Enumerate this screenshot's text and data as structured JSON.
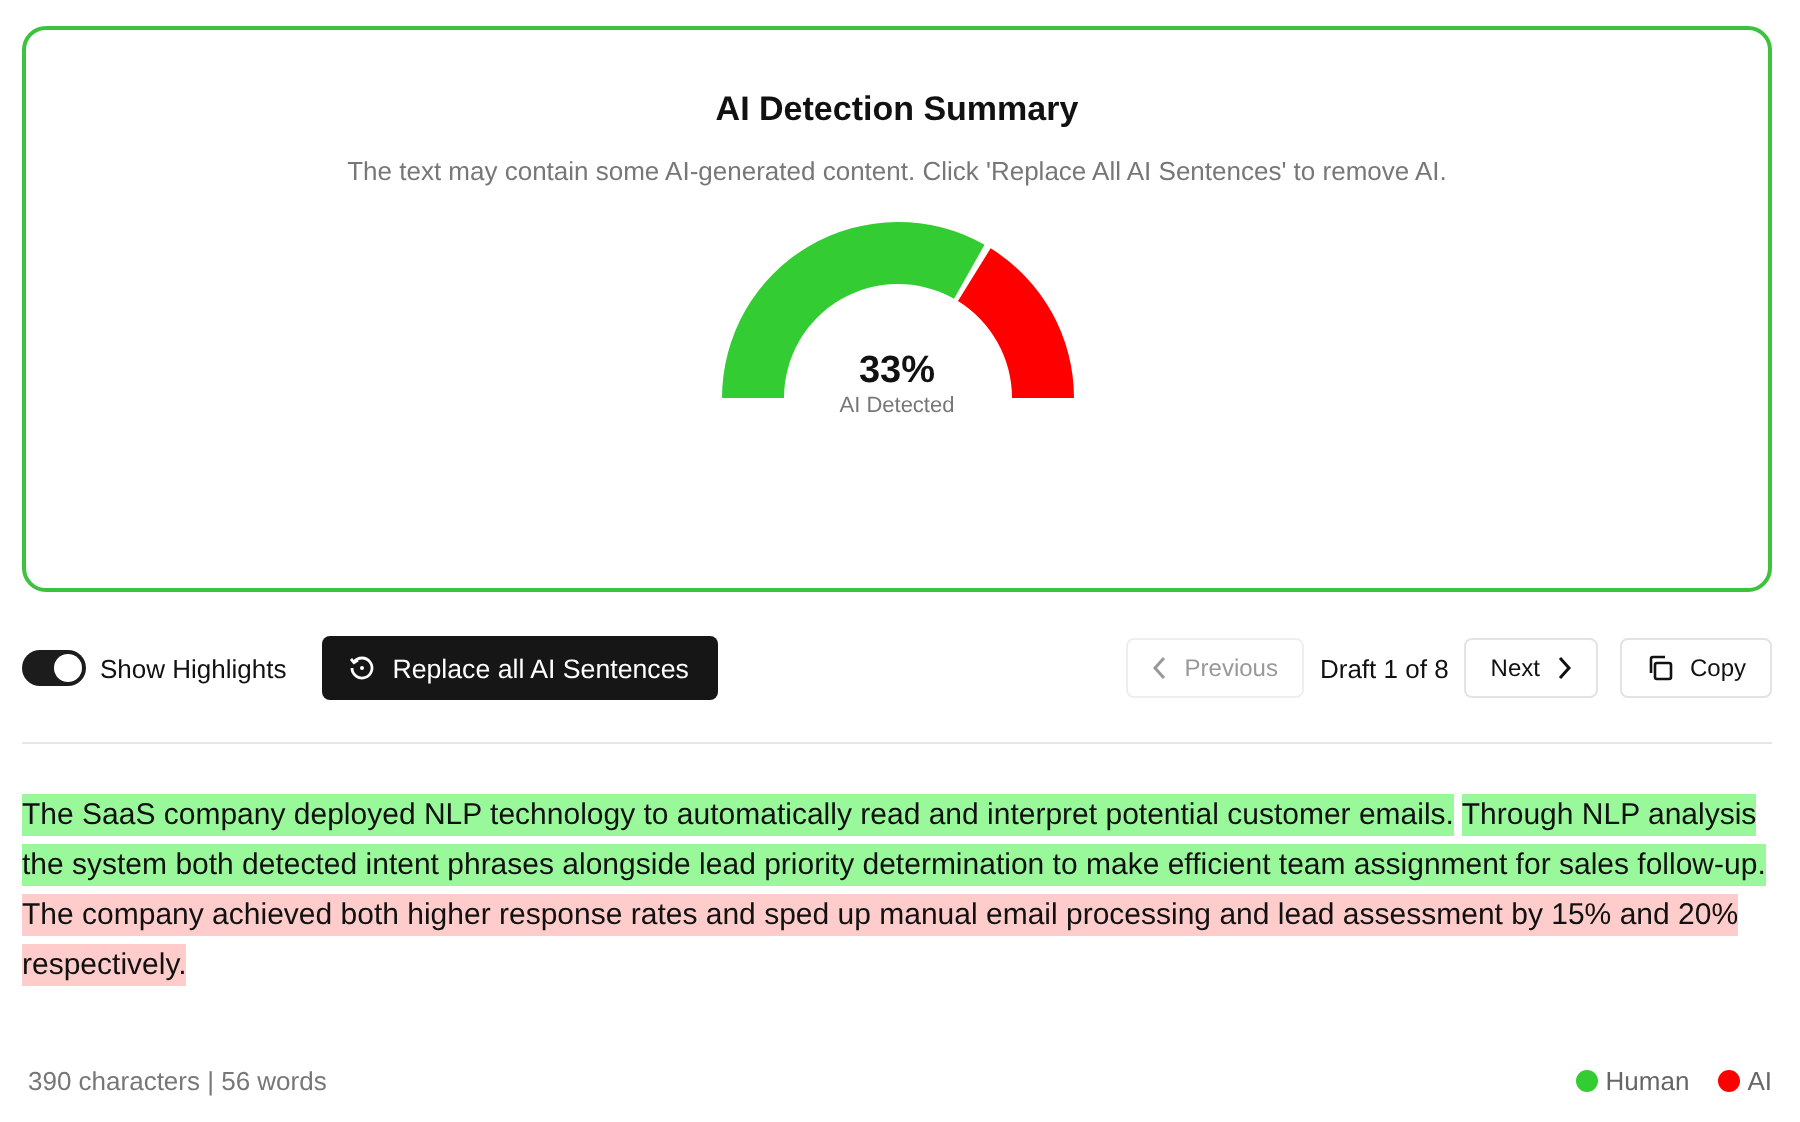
{
  "summary": {
    "title": "AI Detection Summary",
    "subtitle": "The text may contain some AI-generated content. Click 'Replace All AI Sentences' to remove AI.",
    "gauge": {
      "reading": "33%",
      "caption": "AI Detected"
    }
  },
  "toolbar": {
    "highlights_toggle": {
      "label": "Show Highlights",
      "on": true
    },
    "replace_button": "Replace all AI Sentences",
    "previous": {
      "label": "Previous",
      "disabled": true
    },
    "draft": "Draft 1 of 8",
    "next": {
      "label": "Next",
      "disabled": false
    },
    "copy": "Copy"
  },
  "sentences": [
    {
      "text": "The SaaS company deployed NLP technology to automatically read and interpret potential customer emails.",
      "kind": "human"
    },
    {
      "text": "Through NLP analysis the system both detected intent phrases alongside lead priority determination to make efficient team assignment for sales follow-up.",
      "kind": "human"
    },
    {
      "text": "The company achieved both higher response rates and sped up manual email processing and lead assessment by 15% and 20% respectively.",
      "kind": "ai"
    }
  ],
  "footer": {
    "stats": "390 characters | 56 words",
    "legend": [
      {
        "label": "Human",
        "color": "#33cc33"
      },
      {
        "label": "AI",
        "color": "#ff0000"
      }
    ]
  }
}
